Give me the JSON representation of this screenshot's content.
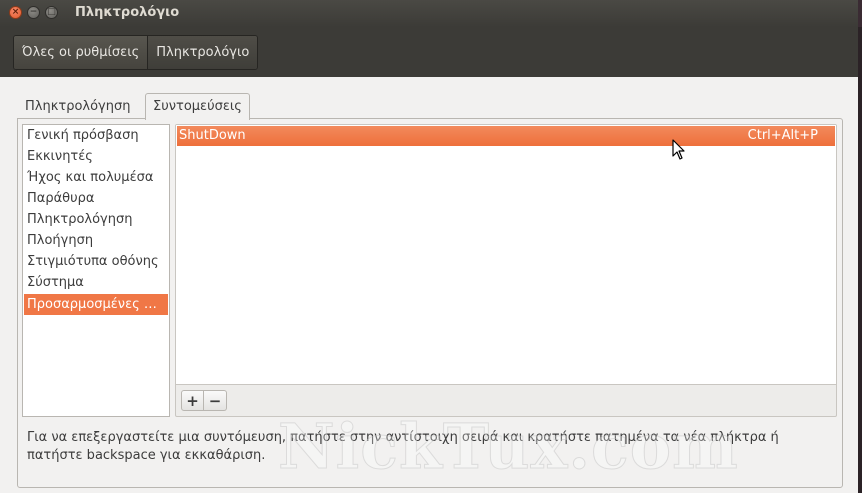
{
  "window": {
    "title": "Πληκτρολόγιο",
    "controls": {
      "close": "×",
      "minimize": "−",
      "maximize": "□"
    }
  },
  "breadcrumbs": [
    {
      "label": "Όλες οι ρυθμίσεις"
    },
    {
      "label": "Πληκτρολόγιο"
    }
  ],
  "tabs": [
    {
      "label": "Πληκτρολόγηση",
      "active": false
    },
    {
      "label": "Συντομεύσεις",
      "active": true
    }
  ],
  "categories": [
    {
      "label": "Γενική πρόσβαση",
      "selected": false
    },
    {
      "label": "Εκκινητές",
      "selected": false
    },
    {
      "label": "Ήχος και πολυμέσα",
      "selected": false
    },
    {
      "label": "Παράθυρα",
      "selected": false
    },
    {
      "label": "Πληκτρολόγηση",
      "selected": false
    },
    {
      "label": "Πλοήγηση",
      "selected": false
    },
    {
      "label": "Στιγμιότυπα οθόνης",
      "selected": false
    },
    {
      "label": "Σύστημα",
      "selected": false
    },
    {
      "label": "Προσαρμοσμένες …",
      "selected": true
    }
  ],
  "shortcuts": [
    {
      "name": "ShutDown",
      "accelerator": "Ctrl+Alt+P",
      "selected": true
    }
  ],
  "buttons": {
    "add": "+",
    "remove": "−"
  },
  "help_text": "Για να επεξεργαστείτε μια συντόμευση, πατήστε στην αντίστοιχη σειρά και κρατήστε πατημένα τα νέα πλήκτρα ή πατήστε backspace για εκκαθάριση.",
  "watermark": "NickTux.com",
  "colors": {
    "accent": "#f07746",
    "titlebar": "#3c3b37",
    "window_bg": "#f2f1f0"
  }
}
